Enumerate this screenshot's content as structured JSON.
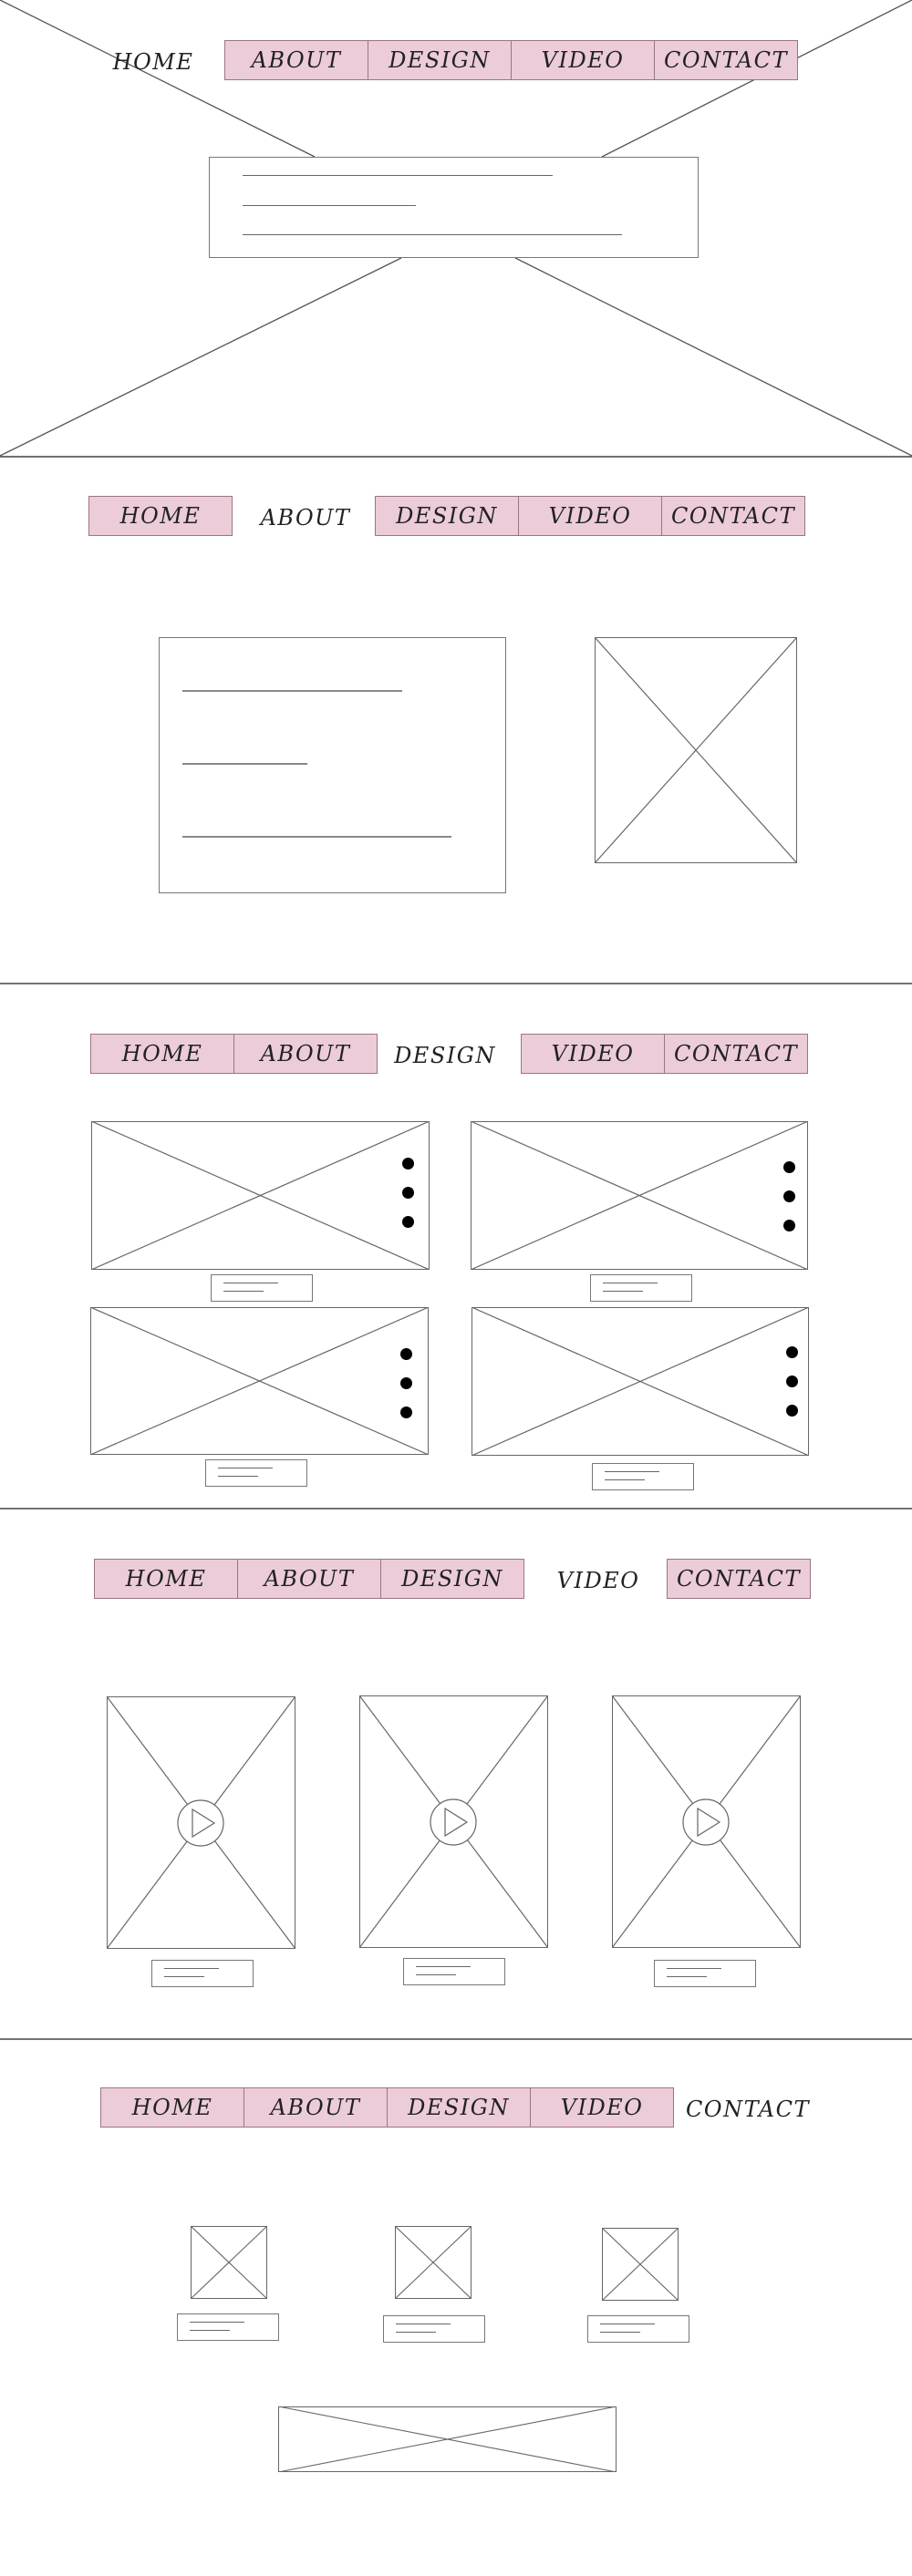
{
  "colors": {
    "nav_fill": "#ecccd9",
    "nav_border": "#9a7584",
    "stroke": "#666666",
    "divider": "#444444"
  },
  "icons": {
    "placeholder": "image-placeholder-icon",
    "play": "play-icon",
    "more": "more-dots-icon"
  },
  "wireframes": [
    {
      "active": "HOME",
      "nav": [
        "HOME",
        "ABOUT",
        "DESIGN",
        "VIDEO",
        "CONTACT"
      ]
    },
    {
      "active": "ABOUT",
      "nav": [
        "HOME",
        "ABOUT",
        "DESIGN",
        "VIDEO",
        "CONTACT"
      ]
    },
    {
      "active": "DESIGN",
      "nav": [
        "HOME",
        "ABOUT",
        "DESIGN",
        "VIDEO",
        "CONTACT"
      ]
    },
    {
      "active": "VIDEO",
      "nav": [
        "HOME",
        "ABOUT",
        "DESIGN",
        "VIDEO",
        "CONTACT"
      ]
    },
    {
      "active": "CONTACT",
      "nav": [
        "HOME",
        "ABOUT",
        "DESIGN",
        "VIDEO",
        "CONTACT"
      ]
    }
  ]
}
